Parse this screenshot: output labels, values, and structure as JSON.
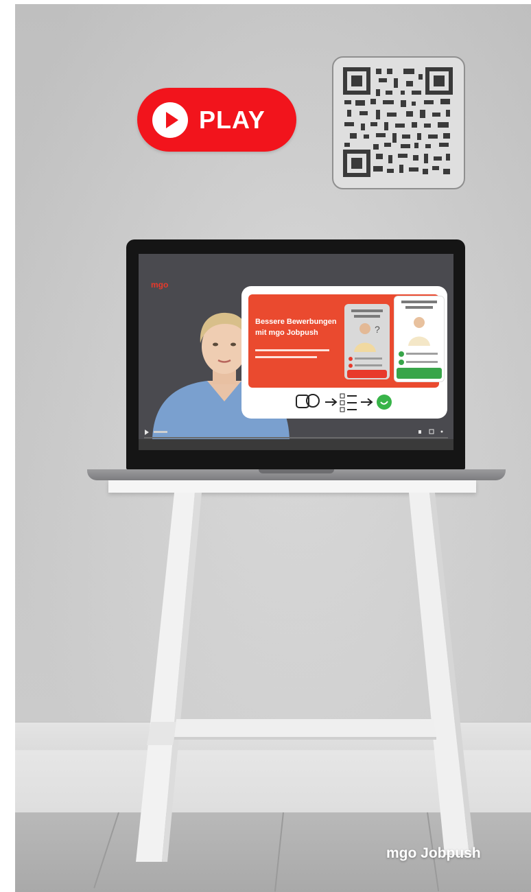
{
  "play_button": {
    "label": "PLAY",
    "color": "#f2141c"
  },
  "qr_code": {
    "icon": "qr-code-icon"
  },
  "laptop": {
    "slide": {
      "logo": "mgo",
      "headline": "Bessere Bewerbungen\nmit mgo Jobpush",
      "accent_color": "#ea4a2f"
    }
  },
  "caption": "mgo Jobpush"
}
